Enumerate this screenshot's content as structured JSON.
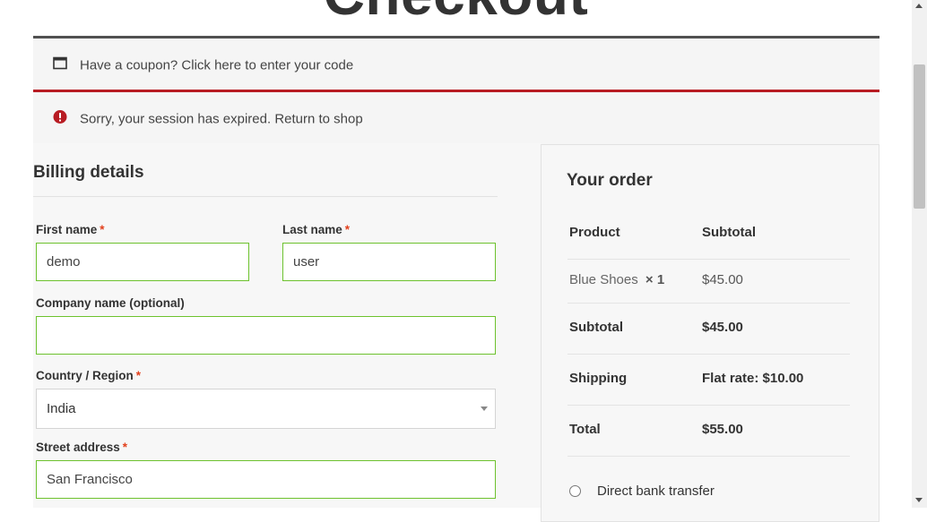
{
  "page": {
    "title": "Checkout"
  },
  "notices": {
    "coupon": {
      "text": "Have a coupon? Click here to enter your code",
      "icon": "window-icon"
    },
    "error": {
      "text": "Sorry, your session has expired. Return to shop",
      "icon": "error-icon",
      "color": "#b81c23"
    }
  },
  "billing": {
    "title": "Billing details",
    "first_name": {
      "label": "First name",
      "value": "demo",
      "required": "*"
    },
    "last_name": {
      "label": "Last name",
      "value": "user",
      "required": "*"
    },
    "company": {
      "label": "Company name (optional)",
      "value": ""
    },
    "country": {
      "label": "Country / Region",
      "value": "India",
      "required": "*"
    },
    "street": {
      "label": "Street address",
      "value": "San Francisco",
      "required": "*"
    }
  },
  "order": {
    "title": "Your order",
    "header": {
      "product": "Product",
      "subtotal": "Subtotal"
    },
    "item": {
      "name": "Blue Shoes",
      "qty": "× 1",
      "price": "$45.00"
    },
    "subtotal": {
      "label": "Subtotal",
      "value": "$45.00"
    },
    "shipping": {
      "label": "Shipping",
      "value": "Flat rate: $10.00"
    },
    "total": {
      "label": "Total",
      "value": "$55.00"
    },
    "payment": {
      "option": "Direct bank transfer"
    }
  },
  "colors": {
    "valid_border": "#6dc22e",
    "required": "#e2401c",
    "notice_border": "#515151"
  }
}
